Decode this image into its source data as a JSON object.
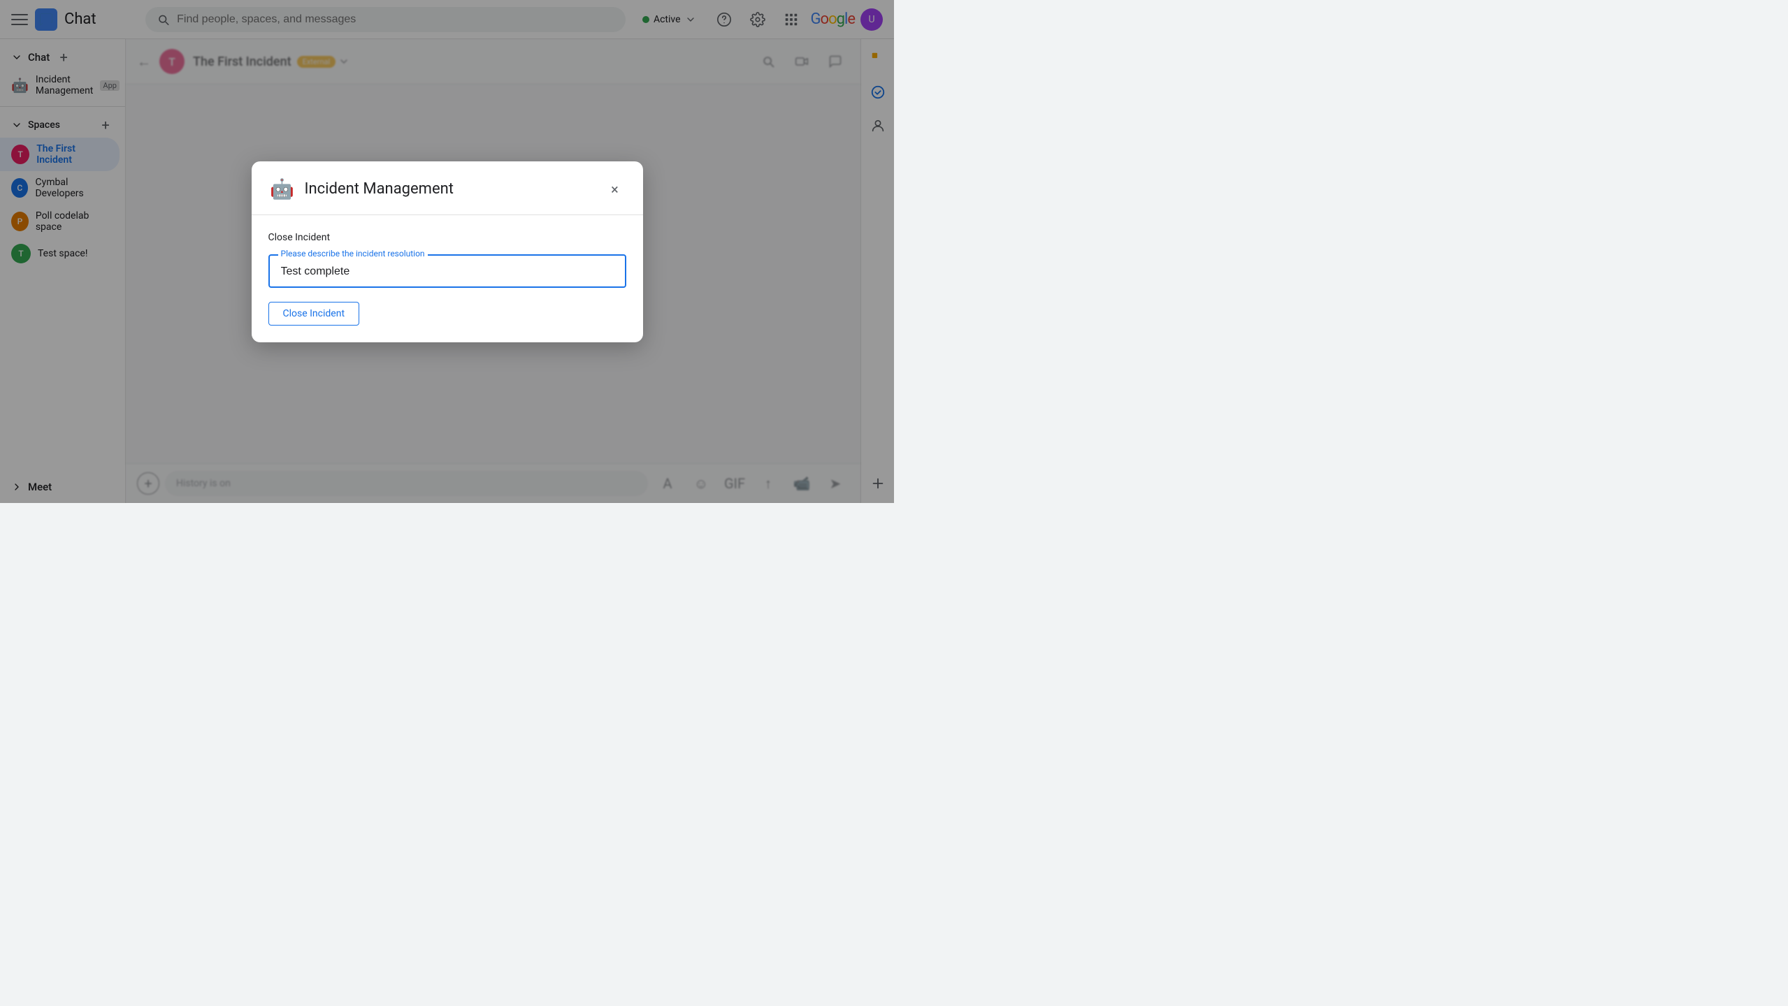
{
  "topbar": {
    "app_title": "Chat",
    "search_placeholder": "Find people, spaces, and messages",
    "status_label": "Active",
    "google_text": "Google"
  },
  "sidebar": {
    "chat_label": "Chat",
    "add_chat_label": "+",
    "incident_mgmt_label": "Incident Management",
    "incident_mgmt_tag": "App",
    "spaces_label": "Spaces",
    "add_space_label": "+",
    "meet_label": "Meet",
    "spaces": [
      {
        "id": "first-incident",
        "label": "The First Incident",
        "initial": "T",
        "color": "#e91e63",
        "active": true
      },
      {
        "id": "cymbal-developers",
        "label": "Cymbal Developers",
        "initial": "C",
        "color": "#1a73e8"
      },
      {
        "id": "poll-codelab",
        "label": "Poll codelab space",
        "initial": "P",
        "color": "#e67c00"
      },
      {
        "id": "test-space",
        "label": "Test space!",
        "initial": "T",
        "color": "#34a853"
      }
    ]
  },
  "chat_header": {
    "title": "The First Incident",
    "external_badge": "External",
    "avatar_initial": "T"
  },
  "message_input": {
    "placeholder": "History is on"
  },
  "dialog": {
    "title": "Incident Management",
    "close_label": "×",
    "section_label": "Close Incident",
    "input_floating_label": "Please describe the incident resolution",
    "input_value": "Test complete",
    "close_btn_label": "Close Incident"
  }
}
